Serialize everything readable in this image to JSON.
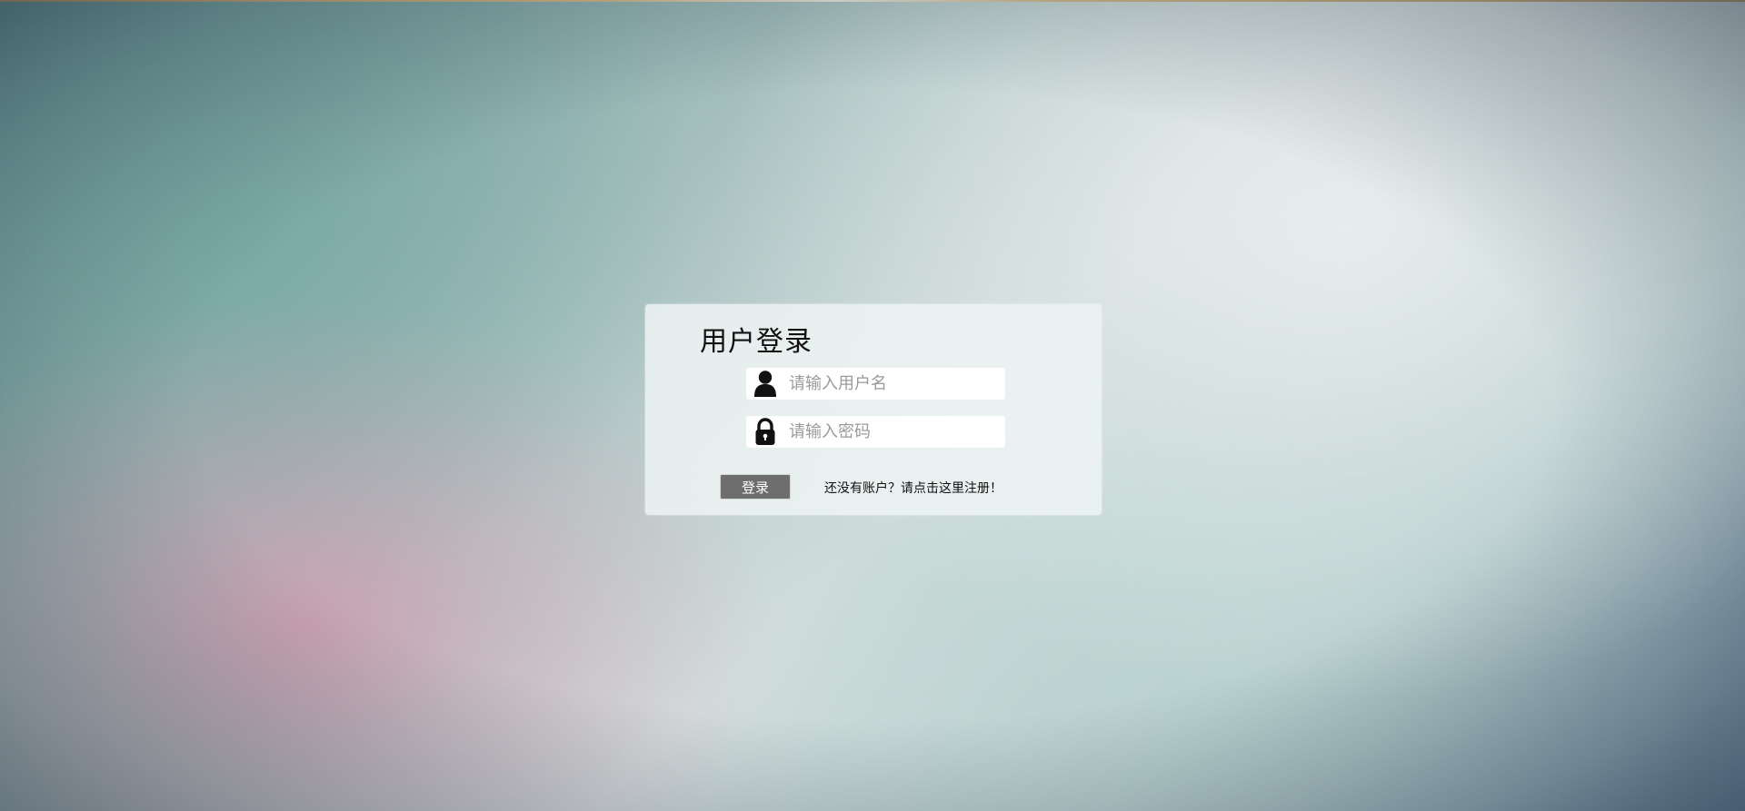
{
  "login": {
    "title": "用户登录",
    "username_placeholder": "请输入用户名",
    "username_value": "",
    "password_placeholder": "请输入密码",
    "password_value": "",
    "submit_label": "登录",
    "register_text": "还没有账户？请点击这里注册！"
  },
  "icons": {
    "username": "user-icon",
    "password": "lock-icon"
  },
  "colors": {
    "button_background": "#6e6e6e",
    "panel_background": "#eef3f3"
  }
}
